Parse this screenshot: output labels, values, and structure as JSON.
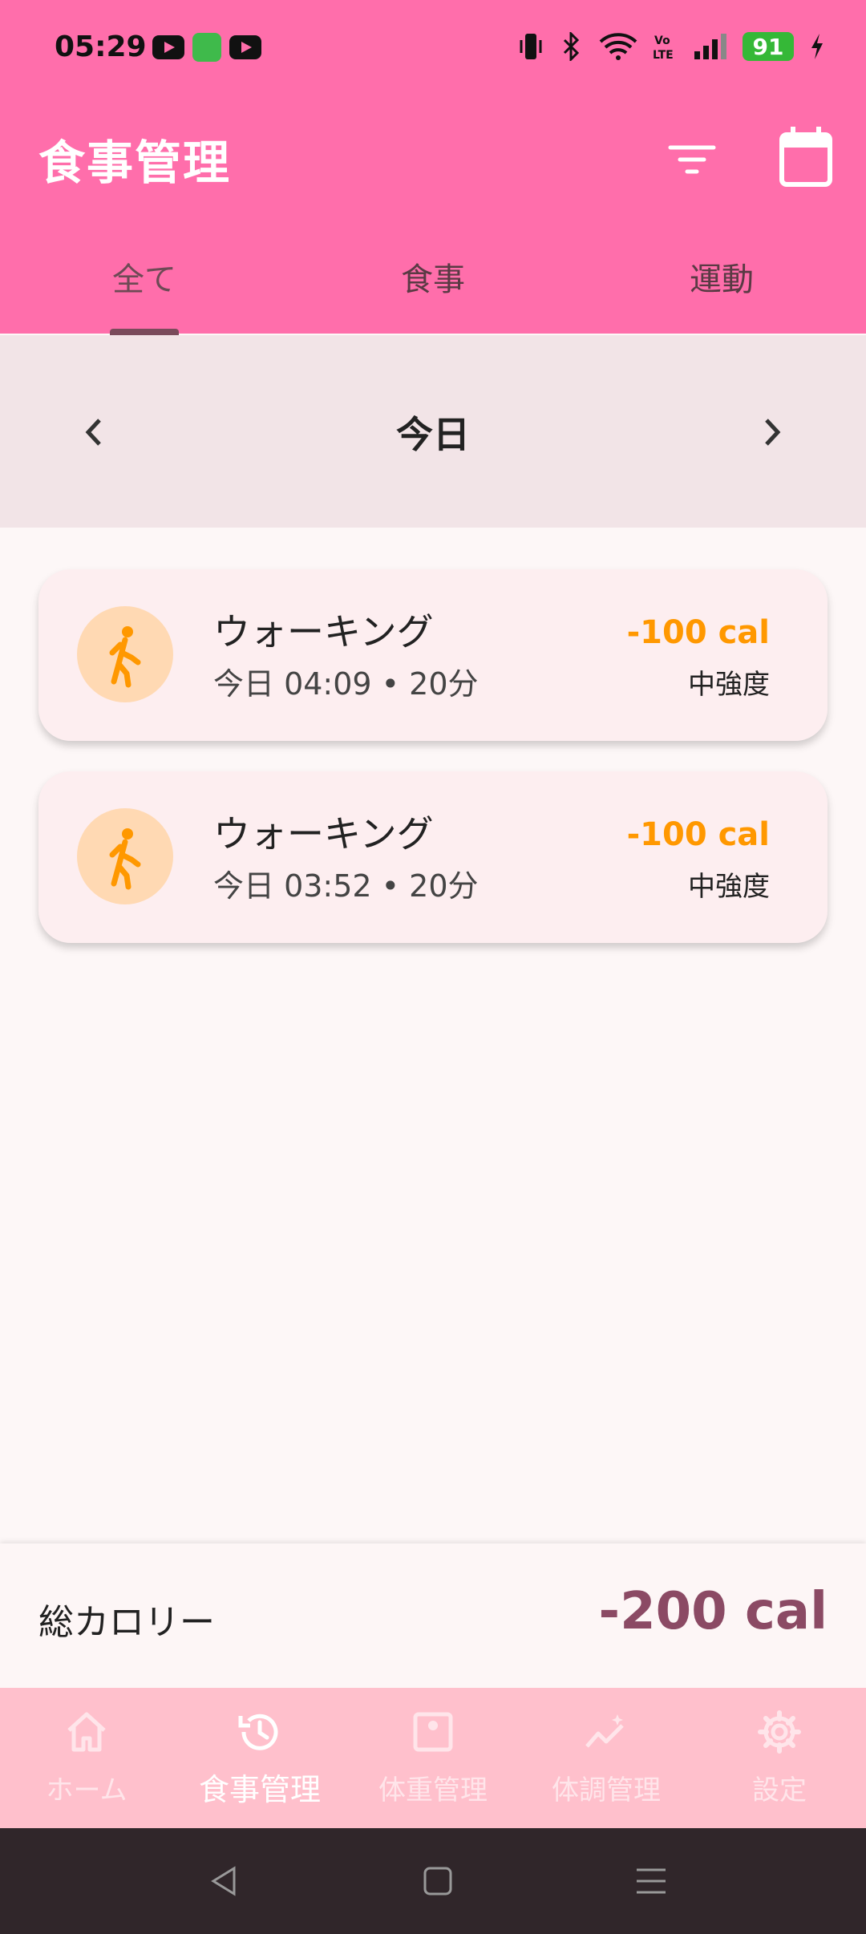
{
  "status_bar": {
    "time": "05:29",
    "battery": "91",
    "icons": [
      "youtube-icon",
      "app-icon",
      "youtube-icon",
      "vibrate-icon",
      "bluetooth-icon",
      "wifi-icon",
      "volte-icon",
      "signal-icon",
      "battery-icon",
      "charging-icon"
    ]
  },
  "app_bar": {
    "title": "食事管理",
    "filter_icon": "filter-icon",
    "calendar_icon": "calendar-icon"
  },
  "tabs": [
    {
      "label": "全て",
      "selected": true
    },
    {
      "label": "食事",
      "selected": false
    },
    {
      "label": "運動",
      "selected": false
    }
  ],
  "date_nav": {
    "label": "今日"
  },
  "entries": [
    {
      "title": "ウォーキング",
      "subtitle": "今日 04:09 • 20分",
      "calories": "-100 cal",
      "intensity": "中強度",
      "icon": "walking-icon"
    },
    {
      "title": "ウォーキング",
      "subtitle": "今日 03:52 • 20分",
      "calories": "-100 cal",
      "intensity": "中強度",
      "icon": "walking-icon"
    }
  ],
  "total": {
    "label": "総カロリー",
    "value": "-200 cal"
  },
  "bottom_nav": [
    {
      "label": "ホーム",
      "icon": "home-icon",
      "active": false
    },
    {
      "label": "食事管理",
      "icon": "history-icon",
      "active": true
    },
    {
      "label": "体重管理",
      "icon": "scale-icon",
      "active": false
    },
    {
      "label": "体調管理",
      "icon": "trend-icon",
      "active": false
    },
    {
      "label": "設定",
      "icon": "gear-icon",
      "active": false
    }
  ],
  "colors": {
    "primary": "#ff6eab",
    "accent_orange": "#ff9800",
    "total_value": "#8b4a64",
    "bottom_nav_bg": "#ffc0cc"
  }
}
